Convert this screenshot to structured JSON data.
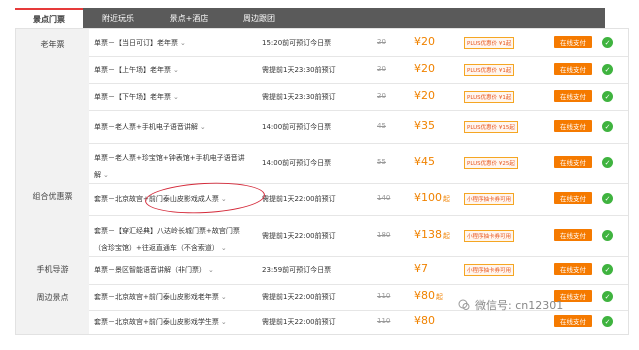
{
  "tabs": [
    "景点门票",
    "附近玩乐",
    "景点+酒店",
    "周边跟团"
  ],
  "colors": {
    "accent": "#f57a00",
    "price": "#f08200",
    "wechat": "#3fb33f",
    "annotation": "#d42a3a"
  },
  "rows": [
    {
      "category": "老年票",
      "name": [
        "单票－【当日可订】老年票"
      ],
      "booking": "15:20前可预订今日票",
      "original": "20",
      "price": "¥20",
      "price_suffix": "",
      "badge": "PLUS优惠价 ¥1起",
      "pay": "在线支付"
    },
    {
      "category": "",
      "name": [
        "单票－【上午场】老年票"
      ],
      "booking": "需提前1天23:30前预订",
      "original": "20",
      "price": "¥20",
      "price_suffix": "",
      "badge": "PLUS优惠价 ¥1起",
      "pay": "在线支付"
    },
    {
      "category": "",
      "name": [
        "单票－【下午场】老年票"
      ],
      "booking": "需提前1天23:30前预订",
      "original": "20",
      "price": "¥20",
      "price_suffix": "",
      "badge": "PLUS优惠价 ¥1起",
      "pay": "在线支付"
    },
    {
      "category": "",
      "name": [
        "单票－老人票+手机电子语音讲解"
      ],
      "booking": "14:00前可预订今日票",
      "original": "45",
      "price": "¥35",
      "price_suffix": "",
      "badge": "PLUS优惠价 ¥15起",
      "pay": "在线支付"
    },
    {
      "category": "",
      "name": [
        "单票－老人票+珍宝馆+钟表馆+手机电子语音讲",
        "解"
      ],
      "booking": "14:00前可预订今日票",
      "original": "55",
      "price": "¥45",
      "price_suffix": "",
      "badge": "PLUS优惠价 ¥25起",
      "pay": "在线支付"
    },
    {
      "category": "组合优惠票",
      "name": [
        "套票－北京故宫+前门泰山皮影戏成人票"
      ],
      "booking": "需提前1天22:00前预订",
      "original": "140",
      "price": "¥100",
      "price_suffix": "起",
      "badge": "小程序抽卡券可用",
      "pay": "在线支付"
    },
    {
      "category": "",
      "name": [
        "套票－【穿汇经典】八达岭长城门票+故宫门票",
        "（含珍宝馆）+往返直通车（不含索道）"
      ],
      "booking": "需提前1天22:00前预订",
      "original": "180",
      "price": "¥138",
      "price_suffix": "起",
      "badge": "小程序抽卡券可用",
      "pay": "在线支付"
    },
    {
      "category": "手机导游",
      "name": [
        "单票－景区智能语音讲解（非门票）"
      ],
      "booking": "23:59前可预订今日票",
      "original": "",
      "price": "¥7",
      "price_suffix": "",
      "badge": "小程序抽卡券可用",
      "pay": "在线支付"
    },
    {
      "category": "周边景点",
      "name": [
        "套票－北京故宫+前门泰山皮影戏老年票"
      ],
      "booking": "需提前1天22:00前预订",
      "original": "110",
      "price": "¥80",
      "price_suffix": "起",
      "badge": "",
      "pay": "在线支付"
    },
    {
      "category": "",
      "name": [
        "套票－北京故宫+前门泰山皮影戏学生票"
      ],
      "booking": "需提前1天22:00前预订",
      "original": "110",
      "price": "¥80",
      "price_suffix": "",
      "badge": "",
      "pay": "在线支付"
    }
  ],
  "watermark": "微信号: cn12301"
}
